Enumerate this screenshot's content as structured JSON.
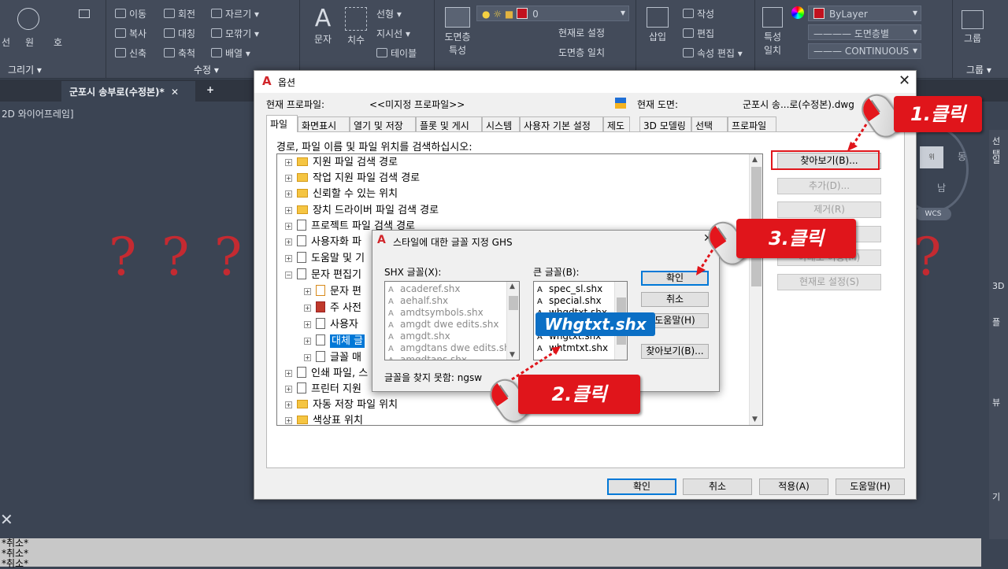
{
  "ribbon": {
    "draw_panel": {
      "label": "그리기 ▾",
      "tools": [
        "선",
        "원",
        "호"
      ]
    },
    "modify_panel": {
      "label": "수정 ▾",
      "tools": [
        "이동",
        "회전",
        "자르기",
        "복사",
        "대칭",
        "모깎기",
        "신축",
        "축척",
        "배열"
      ]
    },
    "annotation_panel": {
      "tools": [
        "문자",
        "치수",
        "선형",
        "지시선",
        "테이블"
      ]
    },
    "layer_panel": {
      "tools": [
        "도면층 특성",
        "현재로 설정",
        "도면층 일치"
      ],
      "layer_value": "0"
    },
    "block_panel": {
      "tools": [
        "삽입",
        "작성",
        "편집",
        "속성 편집"
      ]
    },
    "properties_panel": {
      "tools": [
        "특성 일치"
      ],
      "color": "ByLayer",
      "linetype_top": "도면층별",
      "linetype_bottom": "CONTINUOUS"
    },
    "group_panel": {
      "label": "그룹 ▾",
      "tools": [
        "그룹"
      ]
    }
  },
  "file_tab": {
    "name": "군포시 송부로(수정본)*",
    "close": "✕",
    "new": "+"
  },
  "viewport_label": "2D 와이어프레임]",
  "question_marks": [
    "?",
    "?",
    "?",
    "?"
  ],
  "right_strip": [
    "선택",
    "일",
    "3D",
    "플",
    "뷰",
    "기"
  ],
  "viewcube": {
    "face": "위",
    "east": "동",
    "south": "남",
    "wcs": "WCS"
  },
  "command_line": [
    "*취소*",
    "*취소*",
    "*취소*"
  ],
  "options_dialog": {
    "title": "옵션",
    "current_profile_label": "현재 프로파일:",
    "current_profile_value": "<<미지정 프로파일>>",
    "current_drawing_label": "현재 도면:",
    "current_drawing_value": "군포시 송...로(수정본).dwg",
    "tabs": [
      "파일",
      "화면표시",
      "열기 및 저장",
      "플롯 및 게시",
      "시스템",
      "사용자 기본 설정",
      "제도",
      "3D 모델링",
      "선택",
      "프로파일"
    ],
    "instruction": "경로, 파일 이름 및 파일 위치를 검색하십시오:",
    "tree": [
      "지원 파일 검색 경로",
      "작업 지원 파일 검색 경로",
      "신뢰할 수 있는 위치",
      "장치 드라이버 파일 검색 경로",
      "프로젝트 파일 검색 경로",
      "사용자화 파",
      "도움말 및 기",
      "문자 편집기",
      "문자 편",
      "주 사전",
      "사용자 ",
      "대체 글",
      "글꼴 매",
      "인쇄 파일, 스",
      "프린터 지원",
      "자동 저장 파일 위치",
      "색상표 위치"
    ],
    "side_buttons": [
      "찾아보기(B)...",
      "추가(D)...",
      "제거(R)",
      "위로 이동(U)",
      "아래로 이동(M)",
      "현재로 설정(S)"
    ],
    "bottom_buttons": [
      "확인",
      "취소",
      "적용(A)",
      "도움말(H)"
    ]
  },
  "font_dialog": {
    "title": "스타일에 대한 글꼴 지정 GHS",
    "shx_label": "SHX 글꼴(X):",
    "shx_fonts": [
      "acaderef.shx",
      "aehalf.shx",
      "amdtsymbols.shx",
      "amgdt dwe edits.shx",
      "amgdt.shx",
      "amgdtans dwe edits.shx",
      "amgdtans.shx"
    ],
    "big_label": "큰 글꼴(B):",
    "big_fonts": [
      "spec_sl.shx",
      "special.shx",
      "whgdtxt.shx",
      "whgtxt.shx",
      "whtmtxt.shx"
    ],
    "missing_label": "글꼴을 찾지 못함: ngsw",
    "buttons": [
      "확인",
      "취소",
      "도움말(H)",
      "찾아보기(B)..."
    ]
  },
  "annotations": {
    "step1": "1.클릭",
    "step2": "2.클릭",
    "step3": "3.클릭",
    "font_label": "Whgtxt.shx",
    "accent": "#e0151b",
    "label_blue": "#0b6fc5"
  }
}
